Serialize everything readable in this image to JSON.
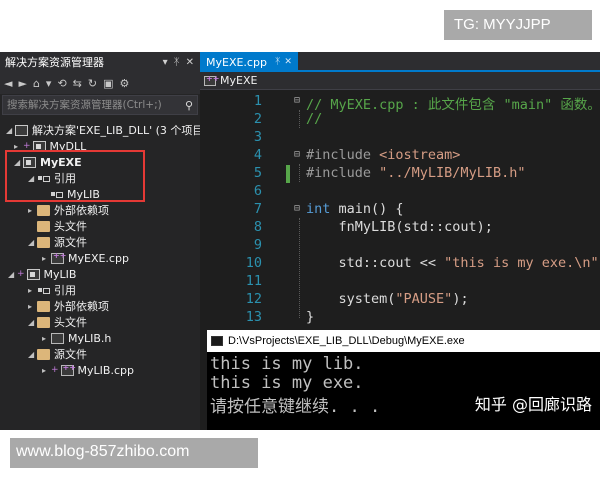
{
  "watermarks": {
    "top": "TG: MYYJJPP",
    "bottom": "www.blog-857zhibo.com",
    "console": "知乎 @回廊识路"
  },
  "solution_explorer": {
    "title": "解决方案资源管理器",
    "pin_icons": [
      "▾",
      "ᛡ",
      "✕"
    ],
    "search_placeholder": "搜索解决方案资源管理器(Ctrl+;)",
    "tree": [
      {
        "label": "解决方案'EXE_LIB_DLL' (3 个项目)",
        "icon": "solution-icon"
      },
      {
        "label": "MyDLL",
        "icon": "project-icon"
      },
      {
        "label": "MyEXE",
        "icon": "project-icon",
        "bold": true
      },
      {
        "label": "引用",
        "icon": "references-icon"
      },
      {
        "label": "MyLIB",
        "icon": "reference-icon"
      },
      {
        "label": "外部依赖项",
        "icon": "folder-icon"
      },
      {
        "label": "头文件",
        "icon": "folder-icon"
      },
      {
        "label": "源文件",
        "icon": "folder-icon"
      },
      {
        "label": "MyEXE.cpp",
        "icon": "cpp-file-icon"
      },
      {
        "label": "MyLIB",
        "icon": "project-icon"
      },
      {
        "label": "引用",
        "icon": "references-icon"
      },
      {
        "label": "外部依赖项",
        "icon": "folder-icon"
      },
      {
        "label": "头文件",
        "icon": "folder-icon"
      },
      {
        "label": "MyLIB.h",
        "icon": "header-file-icon"
      },
      {
        "label": "源文件",
        "icon": "folder-icon"
      },
      {
        "label": "MyLIB.cpp",
        "icon": "cpp-file-icon"
      }
    ]
  },
  "editor": {
    "tab_label": "MyEXE.cpp",
    "tab_icons": [
      "ᛡ",
      "✕"
    ],
    "nav_label": "MyEXE",
    "line_numbers": [
      "1",
      "2",
      "3",
      "4",
      "5",
      "6",
      "7",
      "8",
      "9",
      "10",
      "11",
      "12",
      "13"
    ],
    "code": {
      "l1": "// MyEXE.cpp : 此文件包含 \"main\" 函数。",
      "l2": "//",
      "l4_kw": "#include",
      "l4_str": " <iostream>",
      "l5_kw": "#include",
      "l5_str": " \"../MyLIB/MyLIB.h\"",
      "l7_kw": "int",
      "l7_rest": " main() {",
      "l8": "    fnMyLIB(std::cout);",
      "l10_a": "    std::cout << ",
      "l10_str": "\"this is my exe.\\n\"",
      "l10_b": ";",
      "l12_a": "    system(",
      "l12_str": "\"PAUSE\"",
      "l12_b": ");",
      "l13": "}"
    }
  },
  "console": {
    "title": "D:\\VsProjects\\EXE_LIB_DLL\\Debug\\MyEXE.exe",
    "lines": [
      "this is my lib.",
      "this is my exe.",
      "请按任意键继续. . ."
    ]
  }
}
